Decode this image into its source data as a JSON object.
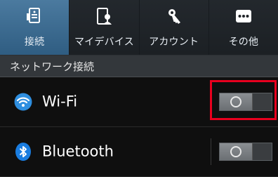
{
  "tabs": [
    {
      "label": "接続",
      "icon": "connections-icon",
      "active": true
    },
    {
      "label": "マイデバイス",
      "icon": "my-device-icon",
      "active": false
    },
    {
      "label": "アカウント",
      "icon": "account-key-icon",
      "active": false
    },
    {
      "label": "その他",
      "icon": "more-icon",
      "active": false
    }
  ],
  "section": {
    "title": "ネットワーク接続"
  },
  "rows": {
    "wifi": {
      "label": "Wi-Fi",
      "icon": "wifi-icon",
      "toggle": "off"
    },
    "bluetooth": {
      "label": "Bluetooth",
      "icon": "bluetooth-icon",
      "toggle": "off"
    }
  },
  "colors": {
    "active_tab": "#3f6f95",
    "highlight": "#e8001e",
    "wifi_icon": "#2f8fe0",
    "bluetooth_icon": "#1a7de0"
  }
}
